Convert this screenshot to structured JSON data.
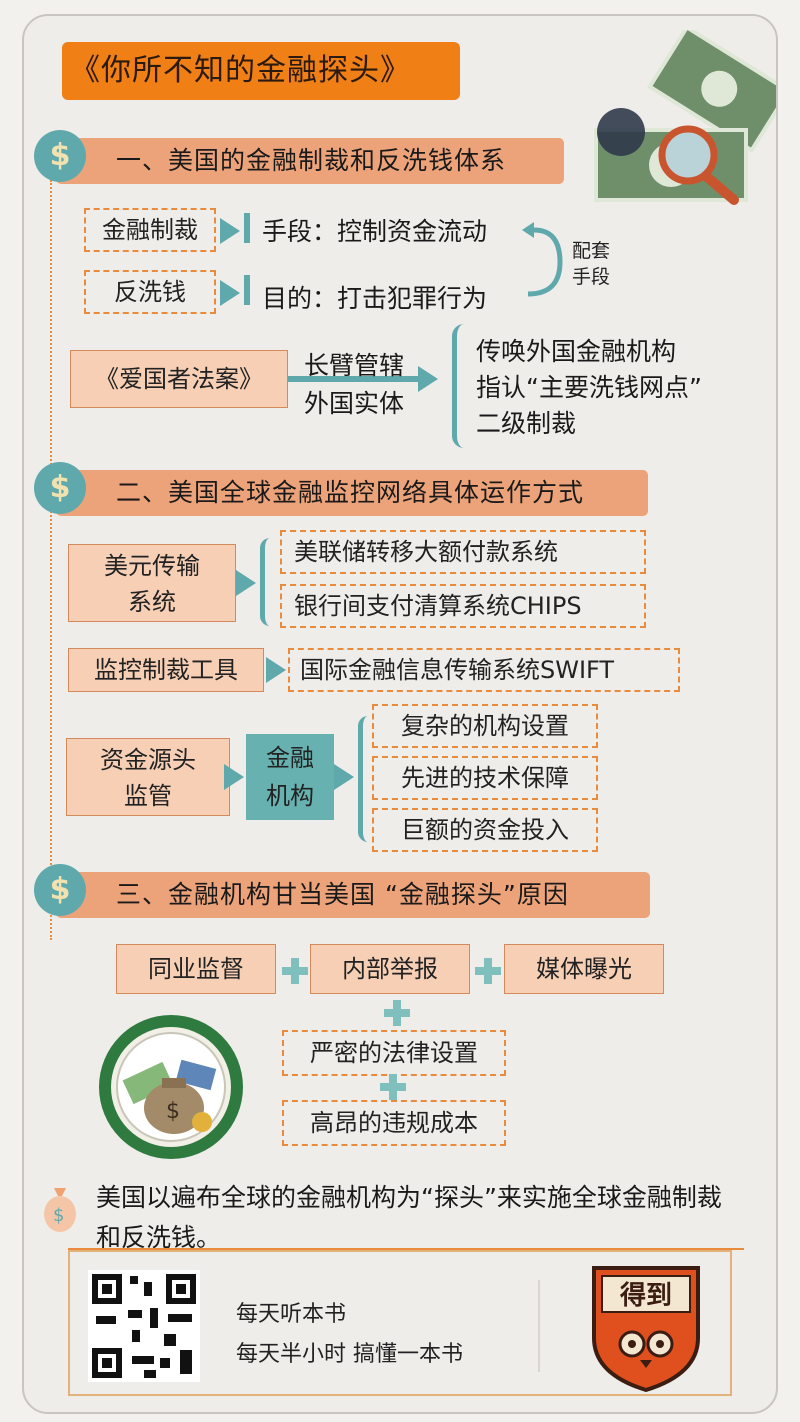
{
  "title": "《你所不知的金融探头》",
  "section1": {
    "heading": "一、美国的金融制裁和反洗钱体系",
    "left_box_1": "金融制裁",
    "right_text_1": "手段：控制资金流动",
    "left_box_2": "反洗钱",
    "right_text_2": "目的：打击犯罪行为",
    "loop_label": "配套\n手段",
    "act_box": "《爱国者法案》",
    "arrow_text_1": "长臂管辖",
    "arrow_text_2": "外国实体",
    "result_1": "传唤外国金融机构",
    "result_2": "指认“主要洗钱网点”",
    "result_3": "二级制裁"
  },
  "section2": {
    "heading": "二、美国全球金融监控网络具体运作方式",
    "box_usd": "美元传输\n系统",
    "usd_item_1": "美联储转移大额付款系统",
    "usd_item_2": "银行间支付清算系统CHIPS",
    "box_monitor": "监控制裁工具",
    "monitor_item": "国际金融信息传输系统SWIFT",
    "box_source": "资金源头\n监管",
    "box_fin": "金融\n机构",
    "fin_item_1": "复杂的机构设置",
    "fin_item_2": "先进的技术保障",
    "fin_item_3": "巨额的资金投入"
  },
  "section3": {
    "heading": "三、金融机构甘当美国 “金融探头”原因",
    "reason_1": "同业监督",
    "reason_2": "内部举报",
    "reason_3": "媒体曝光",
    "reason_4": "严密的法律设置",
    "reason_5": "高昂的违规成本"
  },
  "summary": "美国以遍布全球的金融机构为“探头”来实施全球金融制裁和反洗钱。",
  "footer": {
    "line_1": "每天听本书",
    "line_2": "每天半小时 搞懂一本书",
    "logo_text": "得到"
  },
  "colors": {
    "accent_orange": "#f07f16",
    "section_salmon": "#eda37a",
    "teal": "#5fa9ad",
    "dashed_orange": "#e98a3d"
  }
}
